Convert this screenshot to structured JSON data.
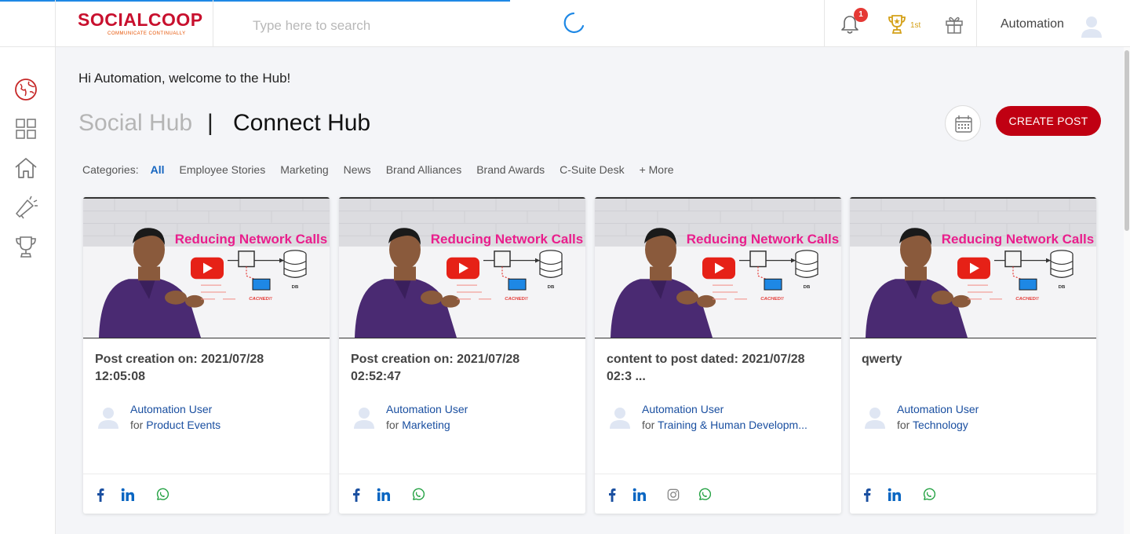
{
  "header": {
    "logo_text": "SOCIALCOOP",
    "logo_tagline": "COMMUNICATE CONTINUALLY",
    "search_placeholder": "Type here to search",
    "notification_count": "1",
    "rank": "1st",
    "username": "Automation"
  },
  "sidebar": {
    "items": [
      "globe-icon",
      "grid-icon",
      "home-icon",
      "megaphone-icon",
      "trophy-icon"
    ]
  },
  "main": {
    "welcome": "Hi Automation, welcome to the Hub!",
    "hub_tabs": [
      "Social Hub",
      "Connect Hub"
    ],
    "separator": "|",
    "create_post": "CREATE POST",
    "categories_label": "Categories:",
    "categories": [
      "All",
      "Employee Stories",
      "Marketing",
      "News",
      "Brand Alliances",
      "Brand Awards",
      "C-Suite Desk",
      "+ More"
    ],
    "active_category": "All"
  },
  "thumbnail": {
    "headline": "Reducing Network Calls",
    "db_label": "DB",
    "cached_label": "CACHED!!"
  },
  "cards": [
    {
      "title_line1": "Post creation on: 2021/07/28",
      "title_line2": "12:05:08",
      "author": "Automation User",
      "for_text": "for",
      "category": "Product Events",
      "share": [
        "facebook",
        "linkedin",
        "whatsapp"
      ]
    },
    {
      "title_line1": "Post creation on: 2021/07/28",
      "title_line2": "02:52:47",
      "author": "Automation User",
      "for_text": "for",
      "category": "Marketing",
      "share": [
        "facebook",
        "linkedin",
        "whatsapp"
      ]
    },
    {
      "title_line1": "content to post dated: 2021/07/28",
      "title_line2": "02:3 ...",
      "author": "Automation User",
      "for_text": "for",
      "category": "Training & Human Developm...",
      "share": [
        "facebook",
        "linkedin",
        "instagram",
        "whatsapp"
      ]
    },
    {
      "title_line1": "qwerty",
      "title_line2": "",
      "author": "Automation User",
      "for_text": "for",
      "category": "Technology",
      "share": [
        "facebook",
        "linkedin",
        "whatsapp"
      ]
    }
  ],
  "colors": {
    "brand_red": "#c00012",
    "link_blue": "#1a4fa0",
    "facebook": "#1a4fa0",
    "linkedin": "#0a66c2",
    "whatsapp": "#25a244"
  }
}
